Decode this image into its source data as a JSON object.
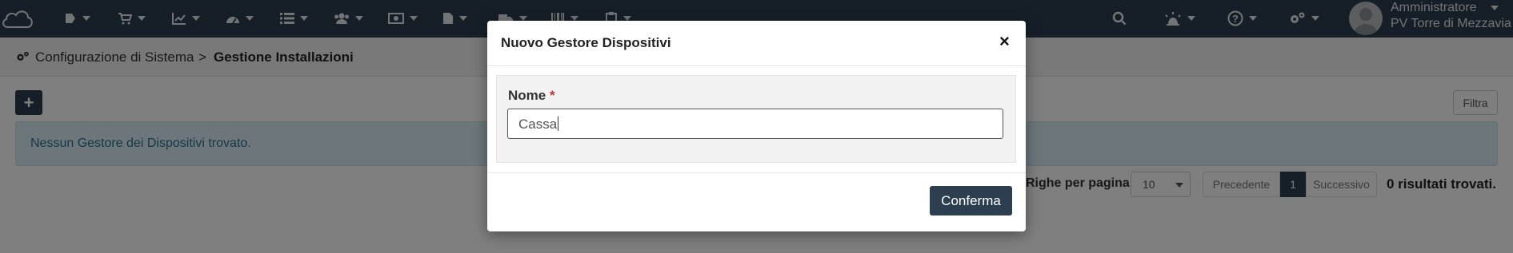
{
  "navbar": {
    "icons": [
      "cloud-logo-icon",
      "shop-icon",
      "cart-icon",
      "chart-icon",
      "dashboard-icon",
      "list-icon",
      "users-icon",
      "money-icon",
      "document-icon",
      "truck-icon",
      "barcode-icon",
      "clipboard-icon",
      "search-icon",
      "alarm-icon",
      "help-icon",
      "settings-icon"
    ],
    "user": {
      "role": "Amministratore",
      "location": "PV Torre di Mezzavia"
    }
  },
  "breadcrumb": {
    "parent": "Configurazione di Sistema",
    "separator": ">",
    "current": "Gestione Installazioni"
  },
  "toolbar": {
    "add_label": "+",
    "filter_label": "Filtra"
  },
  "alert": {
    "message": "Nessun Gestore dei Dispositivi trovato."
  },
  "pagination": {
    "rows_label": "Righe per pagina",
    "rows_value": "10",
    "prev_label": "Precedente",
    "current_page": "1",
    "next_label": "Successivo",
    "results": "0 risultati trovati."
  },
  "modal": {
    "title": "Nuovo Gestore Dispositivi",
    "close_label": "×",
    "field_label": "Nome",
    "required_mark": "*",
    "field_value": "Cassa",
    "confirm_label": "Conferma"
  },
  "colors": {
    "navbar": "#2c3e50",
    "accent": "#2c3e50",
    "alert_bg": "#d9edf7",
    "required": "#c9302c"
  }
}
